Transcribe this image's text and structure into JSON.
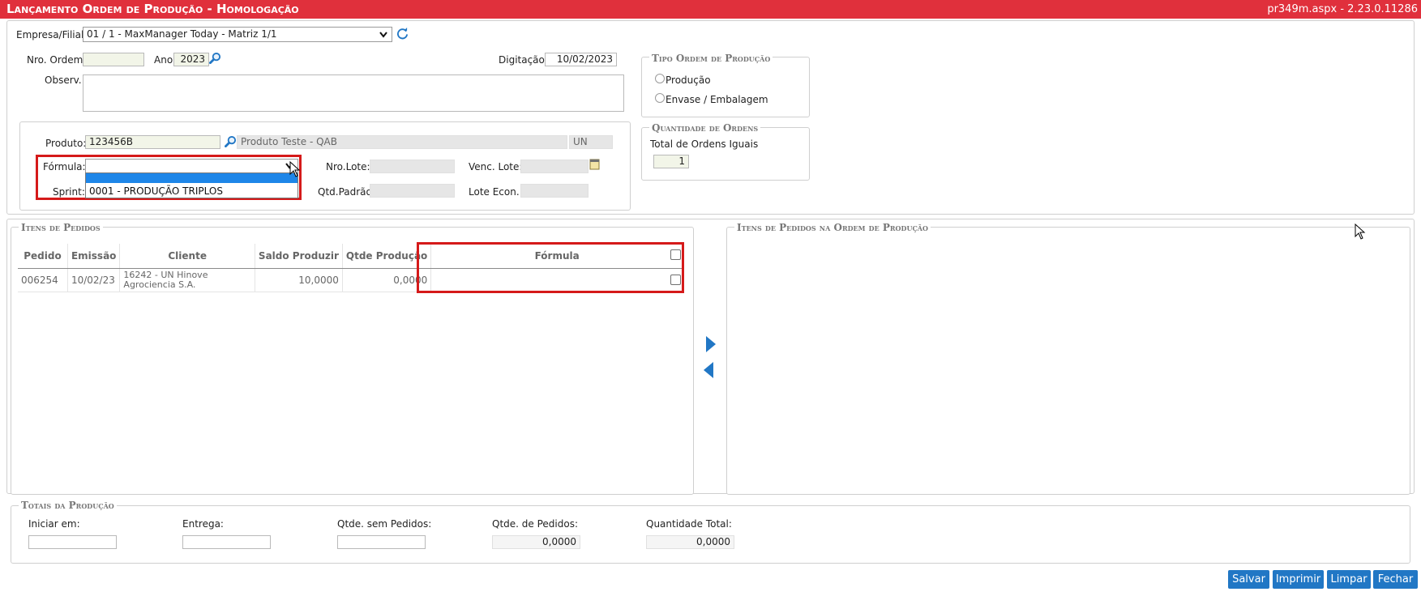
{
  "header": {
    "title": "Lançamento Ordem de Produção  - Homologação",
    "version": "pr349m.aspx - 2.23.0.11286"
  },
  "form": {
    "empresa_label": "Empresa/Filial:",
    "empresa_value": "01 / 1 - MaxManager Today - Matriz 1/1",
    "nro_ordem_label": "Nro. Ordem:",
    "nro_ordem_value": "",
    "ano_label": "Ano:",
    "ano_value": "2023",
    "digitacao_label": "Digitação:",
    "digitacao_value": "10/02/2023",
    "observ_label": "Observ.:",
    "observ_value": ""
  },
  "produto": {
    "produto_label": "Produto:",
    "codigo": "123456B",
    "descricao": "Produto Teste - QAB",
    "unidade": "UN",
    "formula_label": "Fórmula:",
    "formula_value": "",
    "formula_option_highlight": "",
    "formula_option": "0001 - PRODUÇÃO TRIPLOS",
    "sprint_label": "Sprint:",
    "nro_lote_label": "Nro.Lote:",
    "qtd_padrao_label": "Qtd.Padrão:",
    "venc_lote_label": "Venc. Lote:",
    "lote_econ_label": "Lote Econ.:"
  },
  "tipo_ordem": {
    "legend": "Tipo Ordem de Produção",
    "options": [
      "Produção",
      "Envase / Embalagem"
    ]
  },
  "quantidade_ordens": {
    "legend": "Quantidade de Ordens",
    "label": "Total de Ordens Iguais",
    "value": "1"
  },
  "itens_pedidos": {
    "legend": "Itens de Pedidos",
    "columns": [
      "Pedido",
      "Emissão",
      "Cliente",
      "Saldo Produzir",
      "Qtde Produção",
      "Fórmula"
    ],
    "rows": [
      {
        "pedido": "006254",
        "emissao": "10/02/23",
        "cliente": "16242 - UN Hinove Agrociencia S.A.",
        "saldo": "10,0000",
        "qtde": "0,0000",
        "formula": ""
      }
    ]
  },
  "itens_ordem": {
    "legend": "Itens de Pedidos na Ordem de Produção"
  },
  "totais": {
    "legend": "Totais da Produção",
    "iniciar_label": "Iniciar em:",
    "iniciar_value": "",
    "entrega_label": "Entrega:",
    "entrega_value": "",
    "qtde_sem_label": "Qtde. sem Pedidos:",
    "qtde_sem_value": "",
    "qtde_ped_label": "Qtde. de Pedidos:",
    "qtde_ped_value": "0,0000",
    "qtd_total_label": "Quantidade Total:",
    "qtd_total_value": "0,0000"
  },
  "buttons": {
    "salvar": "Salvar",
    "imprimir": "Imprimir",
    "limpar": "Limpar",
    "fechar": "Fechar"
  },
  "colors": {
    "title_bar": "#e0303c",
    "button": "#2177c5",
    "highlight": "#d51a1a",
    "arrow": "#2177c5"
  }
}
